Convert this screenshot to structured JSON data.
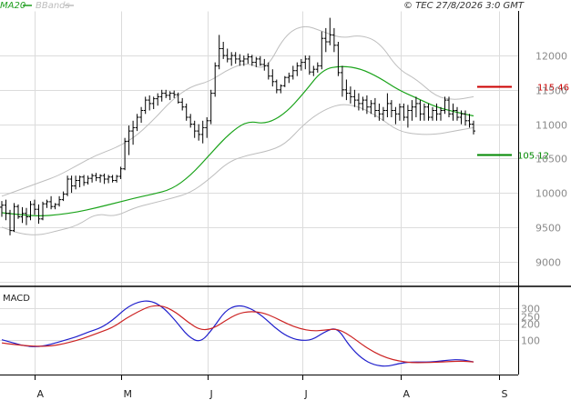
{
  "header": {
    "legend": [
      {
        "name": "MA20",
        "color": "#1f9e1f"
      },
      {
        "name": "BBands",
        "color": "#bdbdbd"
      }
    ],
    "copyright": "© TEC 27/8/2026 3:0 GMT"
  },
  "colors": {
    "price": "#000000",
    "ma20": "#1aa31a",
    "bbands": "#bdbdbd",
    "resistance": "#cc0000",
    "support": "#008800",
    "macd_line": "#1f1fcc",
    "macd_signal": "#cc2222",
    "grid": "#dcdcdc",
    "axis": "#000000"
  },
  "chart_data": [
    {
      "type": "ohlc",
      "panel": "price",
      "y_ticks": [
        "12000",
        "11500",
        "11000",
        "10500",
        "10000",
        "9500",
        "9000"
      ],
      "ylim": [
        8650,
        12650
      ],
      "months": [
        "A",
        "M",
        "J",
        "J",
        "A",
        "S"
      ],
      "levels": [
        {
          "label": "115.46",
          "value": 11546,
          "color": "#cc0000"
        },
        {
          "label": "105.12",
          "value": 10560,
          "color": "#008800"
        }
      ],
      "series": [
        {
          "name": "MA20",
          "kind": "line",
          "values": [
            9710,
            9680,
            9660,
            9680,
            9720,
            9780,
            9850,
            9920,
            9980,
            10050,
            10250,
            10550,
            10850,
            11050,
            11000,
            11150,
            11450,
            11800,
            11850,
            11810,
            11680,
            11500,
            11380,
            11250,
            11180,
            11120
          ]
        },
        {
          "name": "BBands upper",
          "kind": "band",
          "values": [
            9950,
            10050,
            10150,
            10250,
            10400,
            10550,
            10650,
            10800,
            11050,
            11350,
            11550,
            11620,
            11800,
            11900,
            11780,
            12300,
            12450,
            12350,
            12250,
            12300,
            12200,
            11800,
            11650,
            11400,
            11350,
            11400
          ]
        },
        {
          "name": "BBands lower",
          "kind": "band",
          "values": [
            9500,
            9400,
            9380,
            9450,
            9520,
            9700,
            9650,
            9780,
            9850,
            9920,
            10000,
            10200,
            10450,
            10550,
            10600,
            10700,
            11000,
            11200,
            11300,
            11250,
            11100,
            10900,
            10850,
            10850,
            10900,
            10950
          ]
        }
      ],
      "ohlc": [
        [
          9790,
          9880,
          9650,
          9820
        ],
        [
          9820,
          9900,
          9600,
          9700
        ],
        [
          9700,
          9750,
          9380,
          9450
        ],
        [
          9450,
          9850,
          9430,
          9800
        ],
        [
          9800,
          9830,
          9620,
          9650
        ],
        [
          9650,
          9790,
          9560,
          9700
        ],
        [
          9700,
          9780,
          9530,
          9650
        ],
        [
          9650,
          9880,
          9600,
          9830
        ],
        [
          9830,
          9900,
          9680,
          9760
        ],
        [
          9760,
          9830,
          9550,
          9620
        ],
        [
          9620,
          9870,
          9600,
          9840
        ],
        [
          9840,
          9900,
          9780,
          9870
        ],
        [
          9870,
          9950,
          9760,
          9800
        ],
        [
          9800,
          9850,
          9760,
          9830
        ],
        [
          9830,
          9950,
          9800,
          9900
        ],
        [
          9900,
          10020,
          9880,
          9980
        ],
        [
          9980,
          10250,
          9950,
          10200
        ],
        [
          10200,
          10250,
          10000,
          10100
        ],
        [
          10100,
          10250,
          10050,
          10180
        ],
        [
          10180,
          10250,
          10080,
          10230
        ],
        [
          10230,
          10260,
          10100,
          10150
        ],
        [
          10150,
          10250,
          10120,
          10210
        ],
        [
          10210,
          10280,
          10150,
          10250
        ],
        [
          10250,
          10290,
          10170,
          10220
        ],
        [
          10220,
          10270,
          10150,
          10250
        ],
        [
          10250,
          10280,
          10130,
          10200
        ],
        [
          10200,
          10260,
          10140,
          10230
        ],
        [
          10230,
          10260,
          10150,
          10180
        ],
        [
          10180,
          10260,
          10150,
          10240
        ],
        [
          10240,
          10380,
          10200,
          10350
        ],
        [
          10350,
          10800,
          10330,
          10750
        ],
        [
          10750,
          10980,
          10550,
          10900
        ],
        [
          10900,
          11050,
          10700,
          10950
        ],
        [
          10950,
          11150,
          10900,
          11100
        ],
        [
          11100,
          11250,
          11020,
          11200
        ],
        [
          11200,
          11400,
          11150,
          11350
        ],
        [
          11350,
          11420,
          11200,
          11300
        ],
        [
          11300,
          11400,
          11220,
          11370
        ],
        [
          11370,
          11450,
          11270,
          11400
        ],
        [
          11400,
          11500,
          11330,
          11450
        ],
        [
          11450,
          11500,
          11380,
          11420
        ],
        [
          11420,
          11480,
          11350,
          11450
        ],
        [
          11450,
          11490,
          11380,
          11430
        ],
        [
          11430,
          11460,
          11300,
          11320
        ],
        [
          11320,
          11380,
          11200,
          11250
        ],
        [
          11250,
          11300,
          11050,
          11100
        ],
        [
          11100,
          11150,
          10950,
          11000
        ],
        [
          11000,
          11050,
          10800,
          10900
        ],
        [
          10900,
          11000,
          10760,
          10850
        ],
        [
          10850,
          11050,
          10720,
          10950
        ],
        [
          10950,
          11100,
          10800,
          11050
        ],
        [
          11050,
          11500,
          11000,
          11450
        ],
        [
          11450,
          11900,
          11400,
          11850
        ],
        [
          11850,
          12300,
          11800,
          12100
        ],
        [
          12100,
          12200,
          11950,
          12000
        ],
        [
          12000,
          12100,
          11900,
          11950
        ],
        [
          11950,
          12050,
          11850,
          12000
        ],
        [
          12000,
          12050,
          11880,
          11950
        ],
        [
          11950,
          12020,
          11850,
          11920
        ],
        [
          11920,
          12000,
          11850,
          11950
        ],
        [
          11950,
          12030,
          11880,
          11980
        ],
        [
          11980,
          12010,
          11850,
          11900
        ],
        [
          11900,
          11980,
          11830,
          11950
        ],
        [
          11950,
          11990,
          11850,
          11870
        ],
        [
          11870,
          11950,
          11780,
          11850
        ],
        [
          11850,
          11900,
          11650,
          11700
        ],
        [
          11700,
          11800,
          11550,
          11620
        ],
        [
          11620,
          11650,
          11450,
          11500
        ],
        [
          11500,
          11580,
          11450,
          11560
        ],
        [
          11560,
          11700,
          11540,
          11680
        ],
        [
          11680,
          11750,
          11600,
          11700
        ],
        [
          11700,
          11850,
          11650,
          11780
        ],
        [
          11780,
          11900,
          11700,
          11850
        ],
        [
          11850,
          11950,
          11780,
          11900
        ],
        [
          11900,
          12000,
          11800,
          11950
        ],
        [
          11950,
          12000,
          11720,
          11760
        ],
        [
          11760,
          11850,
          11700,
          11800
        ],
        [
          11800,
          11900,
          11750,
          11850
        ],
        [
          11850,
          12350,
          11800,
          12250
        ],
        [
          12250,
          12400,
          12050,
          12200
        ],
        [
          12200,
          12550,
          12150,
          12300
        ],
        [
          12300,
          12400,
          12050,
          12150
        ],
        [
          12150,
          12200,
          11700,
          11750
        ],
        [
          11750,
          11850,
          11400,
          11500
        ],
        [
          11500,
          11650,
          11350,
          11450
        ],
        [
          11450,
          11550,
          11300,
          11400
        ],
        [
          11400,
          11500,
          11250,
          11350
        ],
        [
          11350,
          11450,
          11200,
          11300
        ],
        [
          11300,
          11400,
          11200,
          11350
        ],
        [
          11350,
          11420,
          11150,
          11250
        ],
        [
          11250,
          11350,
          11150,
          11300
        ],
        [
          11300,
          11380,
          11100,
          11200
        ],
        [
          11200,
          11300,
          11050,
          11150
        ],
        [
          11150,
          11250,
          11050,
          11200
        ],
        [
          11200,
          11450,
          11100,
          11300
        ],
        [
          11300,
          11350,
          11100,
          11200
        ],
        [
          11200,
          11250,
          11000,
          11150
        ],
        [
          11150,
          11300,
          11050,
          11250
        ],
        [
          11250,
          11300,
          11050,
          11100
        ],
        [
          11100,
          11280,
          10950,
          11200
        ],
        [
          11200,
          11350,
          11050,
          11250
        ],
        [
          11250,
          11400,
          11100,
          11300
        ],
        [
          11300,
          11350,
          11050,
          11150
        ],
        [
          11150,
          11300,
          11050,
          11250
        ],
        [
          11250,
          11300,
          11050,
          11100
        ],
        [
          11100,
          11250,
          11050,
          11200
        ],
        [
          11200,
          11300,
          11050,
          11150
        ],
        [
          11150,
          11250,
          11050,
          11200
        ],
        [
          11200,
          11400,
          11150,
          11350
        ],
        [
          11350,
          11400,
          11100,
          11150
        ],
        [
          11150,
          11300,
          11050,
          11200
        ],
        [
          11200,
          11250,
          11050,
          11100
        ],
        [
          11100,
          11200,
          11000,
          11150
        ],
        [
          11150,
          11200,
          10980,
          11050
        ],
        [
          11050,
          11150,
          10950,
          11000
        ],
        [
          11000,
          11050,
          10850,
          10900
        ]
      ]
    },
    {
      "type": "line",
      "panel": "macd",
      "title": "MACD",
      "y_ticks": [
        "300",
        "250",
        "200",
        "100"
      ],
      "ylim": [
        -120,
        420
      ],
      "series": [
        {
          "name": "MACD",
          "color": "#1f1fcc",
          "values": [
            100,
            78,
            58,
            55,
            72,
            95,
            118,
            150,
            175,
            228,
            300,
            340,
            348,
            305,
            220,
            120,
            80,
            170,
            285,
            320,
            300,
            250,
            175,
            120,
            95,
            98,
            150,
            180,
            60,
            -20,
            -60,
            -70,
            -50,
            -40,
            -42,
            -38,
            -28,
            -25,
            -40
          ]
        },
        {
          "name": "Signal",
          "color": "#cc2222",
          "values": [
            80,
            70,
            62,
            58,
            60,
            75,
            95,
            120,
            150,
            180,
            235,
            278,
            315,
            315,
            275,
            210,
            160,
            170,
            220,
            265,
            280,
            272,
            240,
            200,
            170,
            155,
            160,
            170,
            130,
            70,
            20,
            -15,
            -35,
            -45,
            -45,
            -42,
            -38,
            -35,
            -40
          ]
        }
      ]
    }
  ]
}
